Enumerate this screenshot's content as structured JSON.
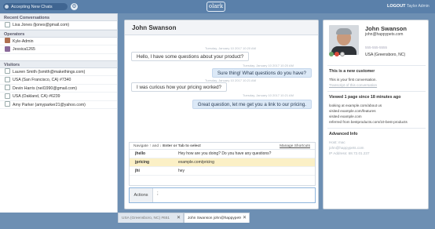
{
  "topbar": {
    "toggle_label": "Accepting New Chats",
    "logo": "olark",
    "logout_label": "LOGOUT",
    "current_user": "Taylor Admin"
  },
  "sidebar": {
    "recent_header": "Recent Conversations",
    "recent": [
      {
        "label": "Lisa Jones (ljones@gmail.com)"
      }
    ],
    "operators_header": "Operators",
    "operators": [
      {
        "label": "Kyle-Admin"
      },
      {
        "label": "Jessica1265"
      }
    ],
    "visitors_header": "Visitors",
    "visitors": [
      {
        "label": "Lauren Smith (lsmith@makethings.com)"
      },
      {
        "label": "USA (San Francisco, CA) #7340"
      },
      {
        "label": "Devin Harris (neil1990@gmail.com)"
      },
      {
        "label": "USA (Oakland, CA) #6239"
      },
      {
        "label": "Amy Parker (amyparker21@yahoo.com)"
      }
    ]
  },
  "chat": {
    "title": "John Swanson",
    "messages": [
      {
        "ts": "Tuesday, January 10 2017 10:20 AM",
        "text": "Hello, I have some questions about your product?",
        "dir": "in"
      },
      {
        "ts": "Tuesday, January 10 2017 10:20 AM",
        "text": "Sure thing! What questions do you have?",
        "dir": "out"
      },
      {
        "ts": "Tuesday, January 10 2017 10:21 AM",
        "text": "I was curious how your pricing worked?",
        "dir": "in"
      },
      {
        "ts": "Tuesday, January 10 2017 10:21 AM",
        "text": "Great question, let me get you a link to our pricing.",
        "dir": "out"
      }
    ],
    "shortcuts": {
      "hint_prefix": "Navigate ↑ and ↓",
      "hint_suffix": "Enter or Tab to select",
      "manage": "Manage Shortcuts",
      "items": [
        {
          "key": "jhello",
          "value": "Hey how are you doing? Do you have any questions?"
        },
        {
          "key": "jpricing",
          "value": "example.com/pricing"
        },
        {
          "key": "jhi",
          "value": "hey"
        }
      ]
    },
    "composer": {
      "actions_label": "Actions",
      "value": ";"
    }
  },
  "visitor": {
    "name": "John Swanson",
    "email": "john@happypets.com",
    "phone": "555-555-5555",
    "location": "USA (Greensboro, NC)",
    "new_customer": "This is a new customer",
    "first_conversation": "This is your first conversation.",
    "transcript_link": "Transcript of this conversation",
    "viewed": "Viewed 1 page since 18 minutes ago",
    "looking_at": "looking at example.com/about us",
    "visited1": "visited example.com/features",
    "visited2": "visited example.com",
    "referred": "referred from bestproducts.com/10-best-products",
    "advanced_header": "Advanced Info",
    "host_os": "Host: mac",
    "host_email": "john@happypets.com",
    "ip": "IP Address: 68.72.01.237"
  },
  "tabs": [
    {
      "label": "USA (Greensboro, NC) #651"
    },
    {
      "label": "John Swanson john@happypets.com"
    }
  ]
}
